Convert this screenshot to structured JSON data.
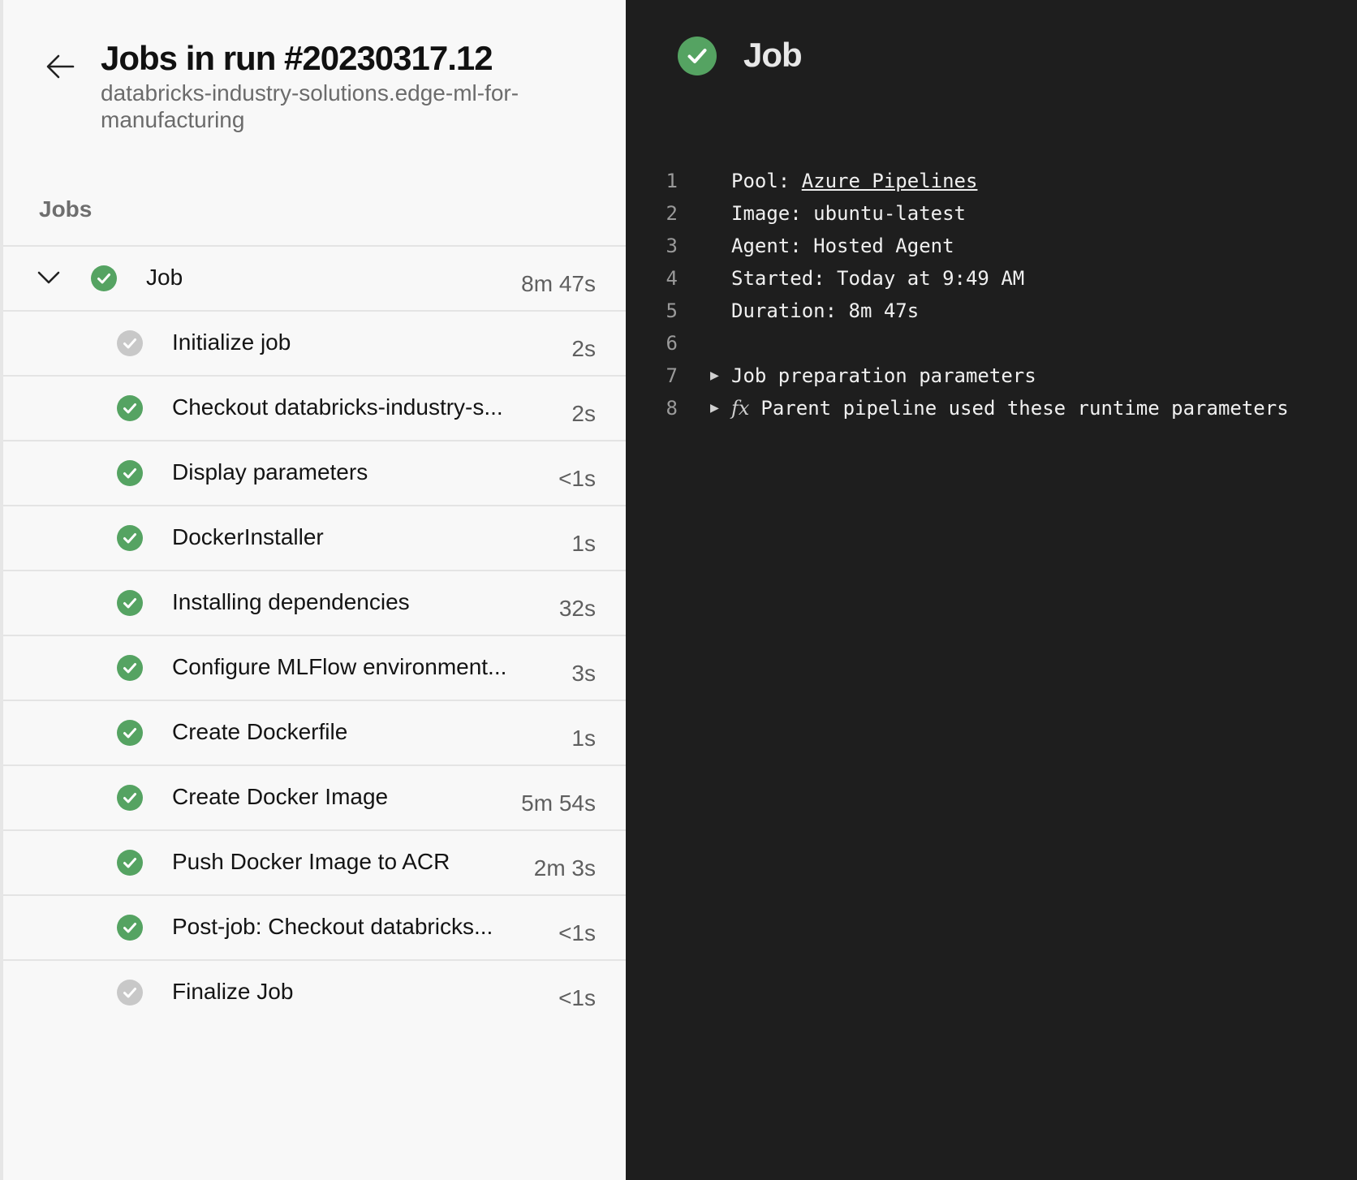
{
  "header": {
    "title": "Jobs in run #20230317.12",
    "subtitle": "databricks-industry-solutions.edge-ml-for-manufacturing"
  },
  "jobs_section_label": "Jobs",
  "job": {
    "name": "Job",
    "duration": "8m 47s",
    "status": "success",
    "expanded": true
  },
  "steps": [
    {
      "label": "Initialize job",
      "duration": "2s",
      "status": "skipped"
    },
    {
      "label": "Checkout databricks-industry-s...",
      "duration": "2s",
      "status": "success"
    },
    {
      "label": "Display parameters",
      "duration": "<1s",
      "status": "success"
    },
    {
      "label": "DockerInstaller",
      "duration": "1s",
      "status": "success"
    },
    {
      "label": "Installing dependencies",
      "duration": "32s",
      "status": "success"
    },
    {
      "label": "Configure MLFlow environment...",
      "duration": "3s",
      "status": "success"
    },
    {
      "label": "Create Dockerfile",
      "duration": "1s",
      "status": "success"
    },
    {
      "label": "Create Docker Image",
      "duration": "5m 54s",
      "status": "success"
    },
    {
      "label": "Push Docker Image to ACR",
      "duration": "2m 3s",
      "status": "success"
    },
    {
      "label": "Post-job: Checkout databricks...",
      "duration": "<1s",
      "status": "success"
    },
    {
      "label": "Finalize Job",
      "duration": "<1s",
      "status": "skipped"
    }
  ],
  "detail": {
    "title": "Job",
    "log": [
      {
        "n": "1",
        "prefix": "Pool: ",
        "link": "Azure Pipelines",
        "text": ""
      },
      {
        "n": "2",
        "text": "Image: ubuntu-latest"
      },
      {
        "n": "3",
        "text": "Agent: Hosted Agent"
      },
      {
        "n": "4",
        "text": "Started: Today at 9:49 AM"
      },
      {
        "n": "5",
        "text": "Duration: 8m 47s"
      },
      {
        "n": "6",
        "text": ""
      },
      {
        "n": "7",
        "text": "Job preparation parameters",
        "expandable": true
      },
      {
        "n": "8",
        "fx": "fx",
        "text": "Parent pipeline used these runtime parameters",
        "expandable": true
      }
    ]
  },
  "colors": {
    "success": "#55a362",
    "skipped": "#c8c8c8",
    "panel_light": "#f8f8f8",
    "panel_dark": "#1e1e1e"
  },
  "icons": {
    "back": "arrow-left-icon",
    "expand": "chevron-down-icon",
    "success": "check-circle-icon",
    "skipped": "check-circle-gray-icon",
    "log_expand": "triangle-right-icon"
  }
}
